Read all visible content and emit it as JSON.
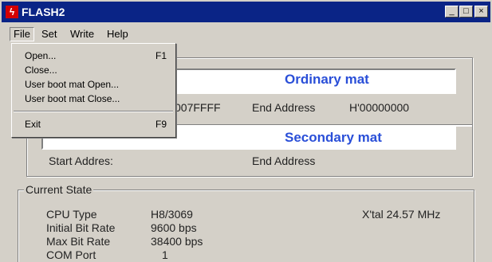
{
  "window": {
    "title": "FLASH2",
    "buttons": [
      "_",
      "□",
      "×"
    ]
  },
  "menubar": {
    "items": [
      "File",
      "Set",
      "Write",
      "Help"
    ]
  },
  "file_menu": {
    "items": [
      {
        "label": "Open...",
        "shortcut": "F1"
      },
      {
        "label": "Close...",
        "shortcut": ""
      },
      {
        "label": "User boot mat Open...",
        "shortcut": ""
      },
      {
        "label": "User boot mat Close...",
        "shortcut": ""
      },
      {
        "label": "Exit",
        "shortcut": "F9"
      }
    ]
  },
  "ordinary": {
    "title": "Ordinary mat",
    "start_value_partial": "007FFFF",
    "end_label": "End Address",
    "end_value": "H'00000000"
  },
  "secondary": {
    "title": "Secondary mat",
    "start_label": "Start Addres:",
    "end_label": "End Address"
  },
  "state": {
    "group_label": "Current State",
    "cpu_label": "CPU Type",
    "cpu_value": "H8/3069",
    "xtal": "X'tal 24.57 MHz",
    "init_label": "Initial Bit Rate",
    "init_value": "9600 bps",
    "max_label": "Max Bit Rate",
    "max_value": "38400 bps",
    "com_label": "COM Port",
    "com_value": "1"
  }
}
